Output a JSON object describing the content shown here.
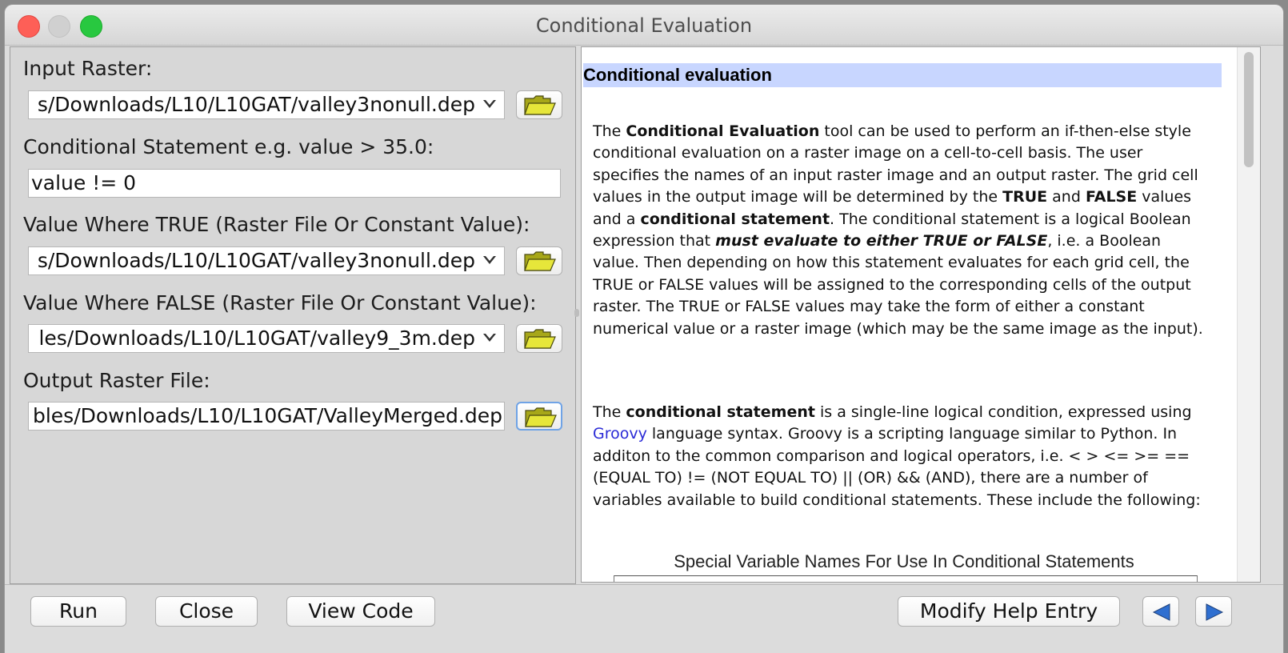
{
  "window": {
    "title": "Conditional Evaluation"
  },
  "form": {
    "input_raster": {
      "label": "Input Raster:",
      "value": "s/Downloads/L10/L10GAT/valley3nonull.dep"
    },
    "conditional_statement": {
      "label": "Conditional Statement e.g. value > 35.0:",
      "value": "value != 0"
    },
    "value_true": {
      "label": "Value Where TRUE (Raster File Or Constant Value):",
      "value": "s/Downloads/L10/L10GAT/valley3nonull.dep"
    },
    "value_false": {
      "label": "Value Where FALSE (Raster File Or Constant Value):",
      "value": "les/Downloads/L10/L10GAT/valley9_3m.dep"
    },
    "output_raster": {
      "label": "Output Raster File:",
      "value": "bles/Downloads/L10/L10GAT/ValleyMerged.dep"
    }
  },
  "help": {
    "heading": "Conditional evaluation",
    "p1": {
      "s1": "The ",
      "b1": "Conditional Evaluation",
      "s2": " tool can be used to perform an if-then-else style conditional evaluation on a raster image on a cell-to-cell basis. The user specifies the names of an input raster image and an output raster. The grid cell values in the output image will be determined by the ",
      "b2": "TRUE",
      "s3": " and ",
      "b3": "FALSE",
      "s4": " values and a ",
      "b4": "conditional statement",
      "s5": ". The conditional statement is a logical Boolean expression that ",
      "bi1": "must evaluate to either TRUE or FALSE",
      "s6": ", i.e. a Boolean value. Then depending on how this statement evaluates for each grid cell, the TRUE or FALSE values will be assigned to the corresponding cells of the output raster. The TRUE or FALSE values may take the form of either a constant numerical value or a raster image (which may be the same image as the input)."
    },
    "p2": {
      "s1": "The ",
      "b1": "conditional statement",
      "s2": " is a single-line logical condition, expressed using ",
      "link": "Groovy",
      "s3": " language syntax. Groovy is a scripting language similar to Python. In additon to the common comparison and logical operators, i.e. < > <= >= == (EQUAL TO) != (NOT EQUAL TO) || (OR) && (AND), there are a number of variables available to build conditional statements. These include the following:"
    },
    "table_caption": "Special Variable Names For Use In Conditional Statements"
  },
  "buttons": {
    "run": "Run",
    "close": "Close",
    "view_code": "View Code",
    "modify_help": "Modify Help Entry"
  },
  "colors": {
    "accent": "#6fa3e6",
    "heading_bg": "#c8d6ff",
    "link": "#2a2ad6"
  }
}
